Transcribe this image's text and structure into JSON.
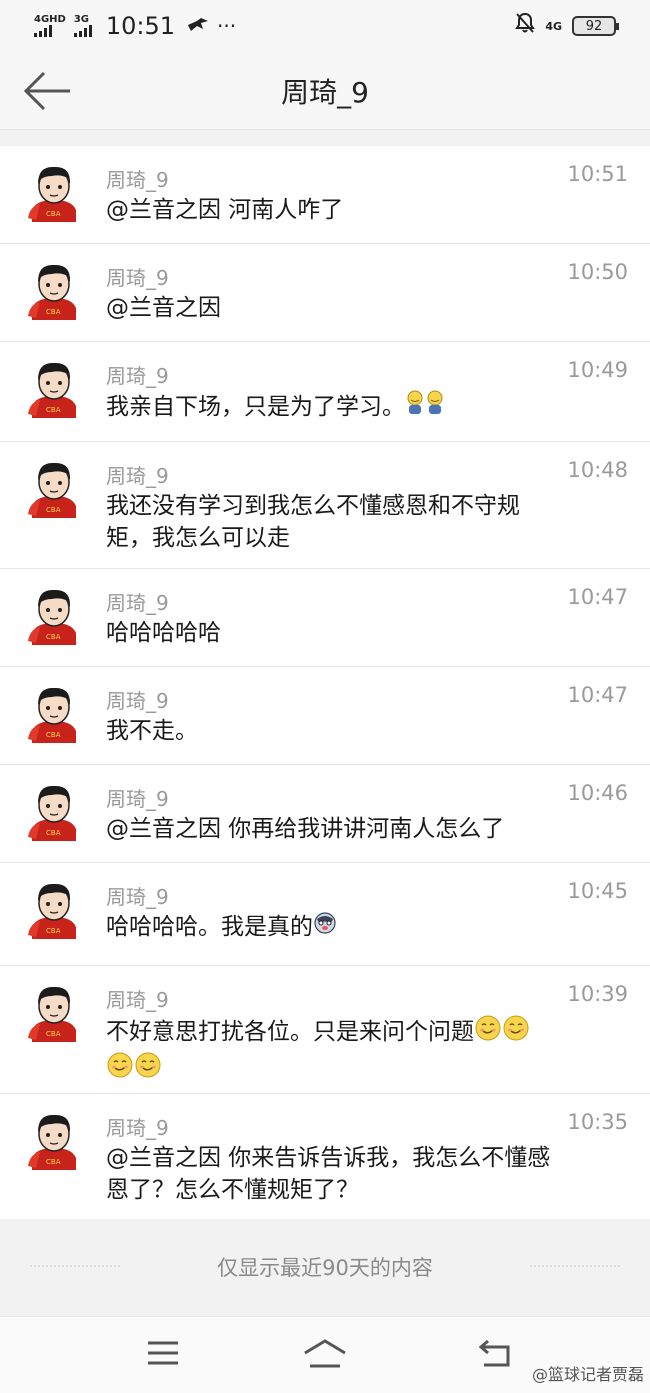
{
  "status_bar": {
    "signal1_label": "4GHD",
    "signal2_label": "3G",
    "time": "10:51",
    "extra": "···",
    "lte_label": "4G",
    "battery": "92"
  },
  "header": {
    "title": "周琦_9",
    "back_icon": "arrow-left-icon"
  },
  "messages": [
    {
      "sender": "周琦_9",
      "time": "10:51",
      "text": "@兰音之因 河南人咋了",
      "emojis": []
    },
    {
      "sender": "周琦_9",
      "time": "10:50",
      "text": "@兰音之因",
      "emojis": []
    },
    {
      "sender": "周琦_9",
      "time": "10:49",
      "text": "我亲自下场，只是为了学习。",
      "emojis": [
        "laugh-cry-emoji",
        "laugh-cry-emoji"
      ]
    },
    {
      "sender": "周琦_9",
      "time": "10:48",
      "text": "我还没有学习到我怎么不懂感恩和不守规矩，我怎么可以走",
      "emojis": []
    },
    {
      "sender": "周琦_9",
      "time": "10:47",
      "text": "哈哈哈哈哈",
      "emojis": []
    },
    {
      "sender": "周琦_9",
      "time": "10:47",
      "text": "我不走。",
      "emojis": []
    },
    {
      "sender": "周琦_9",
      "time": "10:46",
      "text": "@兰音之因 你再给我讲讲河南人怎么了",
      "emojis": []
    },
    {
      "sender": "周琦_9",
      "time": "10:45",
      "text": "哈哈哈哈。我是真的",
      "emojis": [
        "husky-emoji"
      ]
    },
    {
      "sender": "周琦_9",
      "time": "10:39",
      "text": "不好意思打扰各位。只是来问个问题",
      "emojis": [
        "smirk-emoji",
        "smirk-emoji",
        "smirk-emoji",
        "smirk-emoji"
      ]
    },
    {
      "sender": "周琦_9",
      "time": "10:35",
      "text": "@兰音之因 你来告诉告诉我，我怎么不懂感恩了？怎么不懂规矩了？",
      "emojis": []
    }
  ],
  "footer_note": "仅显示最近90天的内容",
  "navbar": {
    "menu_icon": "menu-icon",
    "home_icon": "home-icon",
    "back_icon": "return-icon"
  },
  "watermark": "@篮球记者贾磊",
  "colors": {
    "background": "#f2f2f2",
    "card": "#ffffff",
    "meta_text": "#999999",
    "body_text": "#1a1a1a"
  }
}
